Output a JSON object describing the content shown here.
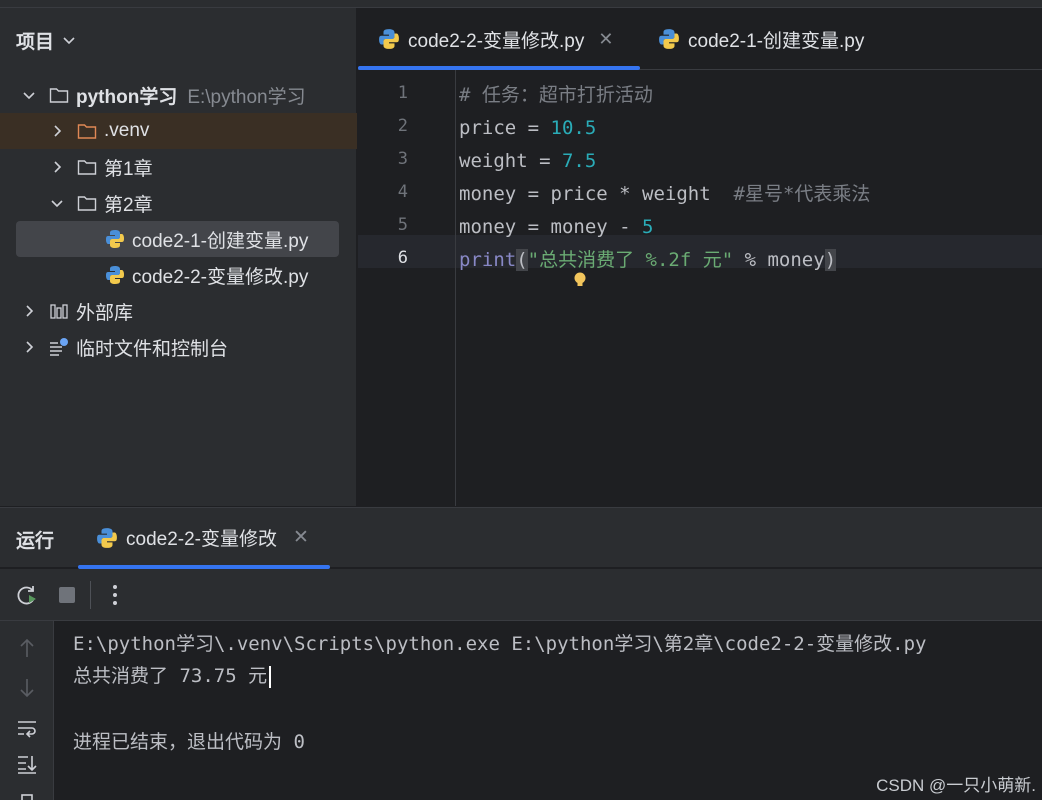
{
  "project_panel": {
    "title": "项目",
    "tree": [
      {
        "label": "python学习",
        "hint": "E:\\python学习",
        "icon": "folder-icon"
      },
      {
        "label": ".venv",
        "icon": "folder-icon"
      },
      {
        "label": "第1章",
        "icon": "folder-icon"
      },
      {
        "label": "第2章",
        "icon": "folder-icon"
      },
      {
        "label": "code2-1-创建变量.py",
        "icon": "python-file-icon"
      },
      {
        "label": "code2-2-变量修改.py",
        "icon": "python-file-icon"
      },
      {
        "label": "外部库",
        "icon": "library-icon"
      },
      {
        "label": "临时文件和控制台",
        "icon": "scratches-icon"
      }
    ]
  },
  "editor": {
    "tabs": [
      {
        "label": "code2-2-变量修改.py",
        "active": true
      },
      {
        "label": "code2-1-创建变量.py",
        "active": false
      }
    ],
    "line_numbers": [
      "1",
      "2",
      "3",
      "4",
      "5",
      "6"
    ],
    "code": {
      "line1": {
        "comment": "# 任务：超市打折活动"
      },
      "line2": {
        "var": "price",
        "op": " = ",
        "num": "10.5"
      },
      "line3": {
        "var": "weight",
        "op": " = ",
        "num": "7.5"
      },
      "line4": {
        "text": "money = price * weight  ",
        "comment": "#星号*代表乘法"
      },
      "line5": {
        "text": "money = money - ",
        "num": "5"
      },
      "line6": {
        "builtin": "print",
        "open": "(",
        "str": "\"总共消费了 %.2f 元\"",
        "text": " % money",
        "close": ")"
      }
    }
  },
  "run_panel": {
    "title": "运行",
    "tab_label": "code2-2-变量修改",
    "output": [
      "E:\\python学习\\.venv\\Scripts\\python.exe E:\\python学习\\第2章\\code2-2-变量修改.py",
      "总共消费了 73.75 元",
      "进程已结束，退出代码为 0"
    ]
  },
  "watermark": "CSDN @一只小萌新.",
  "colors": {
    "accent": "#3574f0",
    "background": "#1e1f22",
    "panel": "#2b2d30"
  }
}
